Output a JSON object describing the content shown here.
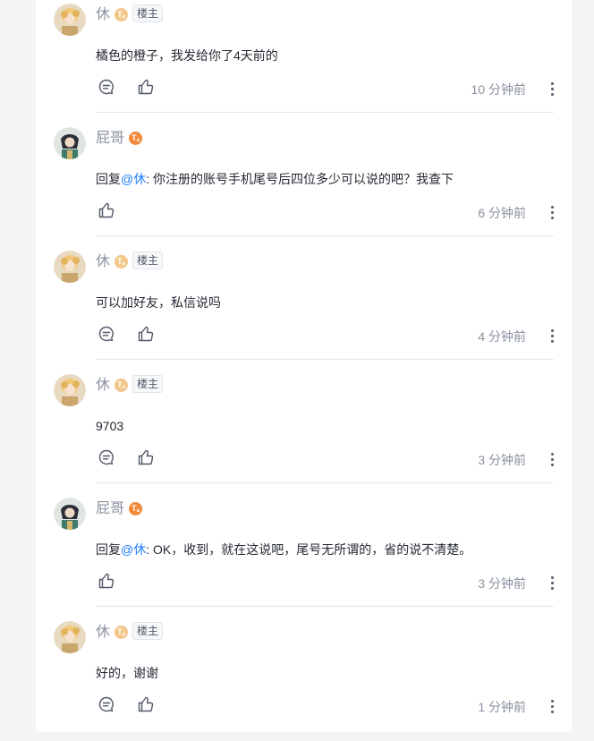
{
  "comments": [
    {
      "author": "休",
      "level_badge": "T",
      "level_sub": "a",
      "author_tag": "楼主",
      "mention": "",
      "reply_prefix": "",
      "text": "橘色的橙子，我发给你了4天前的",
      "time": "10 分钟前",
      "has_reply_icon": true,
      "avatar": "blonde-avatar"
    },
    {
      "author": "屁哥",
      "level_badge": "T",
      "level_sub": "a",
      "author_tag": "",
      "reply_prefix": "回复",
      "mention": "@休",
      "text": ": 你注册的账号手机尾号后四位多少可以说的吧？我查下",
      "time": "6 分钟前",
      "has_reply_icon": false,
      "avatar": "dark-avatar"
    },
    {
      "author": "休",
      "level_badge": "T",
      "level_sub": "a",
      "author_tag": "楼主",
      "mention": "",
      "reply_prefix": "",
      "text": "可以加好友，私信说吗",
      "time": "4 分钟前",
      "has_reply_icon": true,
      "avatar": "blonde-avatar"
    },
    {
      "author": "休",
      "level_badge": "T",
      "level_sub": "a",
      "author_tag": "楼主",
      "mention": "",
      "reply_prefix": "",
      "text": "9703",
      "time": "3 分钟前",
      "has_reply_icon": true,
      "avatar": "blonde-avatar"
    },
    {
      "author": "屁哥",
      "level_badge": "T",
      "level_sub": "a",
      "author_tag": "",
      "reply_prefix": "回复",
      "mention": "@休",
      "text": ": OK，收到，就在这说吧，尾号无所谓的，省的说不清楚。",
      "time": "3 分钟前",
      "has_reply_icon": false,
      "avatar": "dark-avatar"
    },
    {
      "author": "休",
      "level_badge": "T",
      "level_sub": "a",
      "author_tag": "楼主",
      "mention": "",
      "reply_prefix": "",
      "text": "好的，谢谢",
      "time": "1 分钟前",
      "has_reply_icon": true,
      "avatar": "blonde-avatar"
    }
  ],
  "colors": {
    "mention": "#1e80ff",
    "meta_text": "#8a919f",
    "body_text": "#252933",
    "badge_pale": "#f3c689",
    "badge_orange": "#f08a3a"
  },
  "icons": [
    "comment-icon",
    "like-icon",
    "more-icon"
  ]
}
